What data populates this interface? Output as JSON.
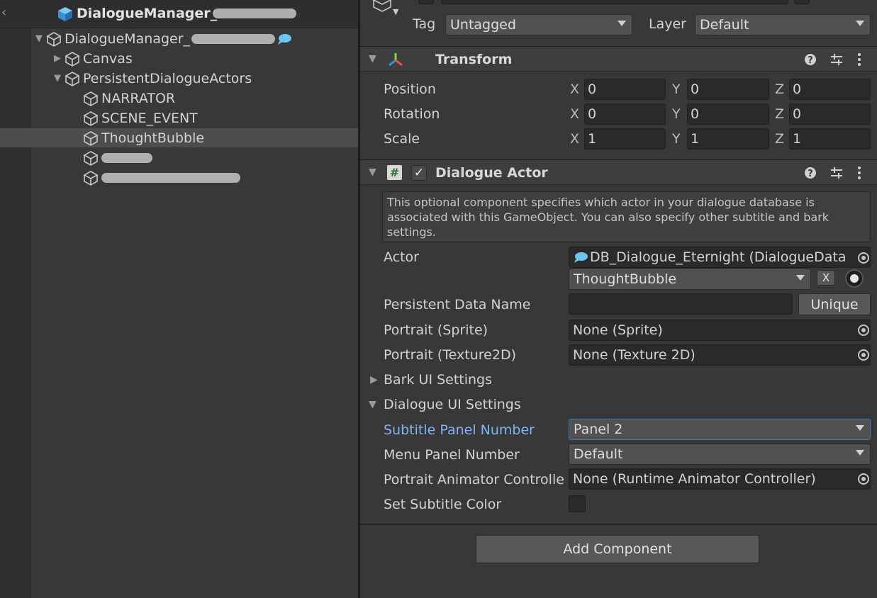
{
  "hierarchy": {
    "scene_name": "DialogueManager_",
    "items": [
      {
        "label": "DialogueManager_",
        "expanded": true,
        "icon": "speech-bubble-icon"
      },
      {
        "label": "Canvas",
        "expanded": false
      },
      {
        "label": "PersistentDialogueActors",
        "expanded": true
      },
      {
        "label": "NARRATOR"
      },
      {
        "label": "SCENE_EVENT"
      },
      {
        "label": "ThoughtBubble",
        "selected": true
      }
    ]
  },
  "inspector": {
    "tag_label": "Tag",
    "tag_value": "Untagged",
    "layer_label": "Layer",
    "layer_value": "Default",
    "transform": {
      "title": "Transform",
      "rows": [
        {
          "label": "Position",
          "x": "0",
          "y": "0",
          "z": "0"
        },
        {
          "label": "Rotation",
          "x": "0",
          "y": "0",
          "z": "0"
        },
        {
          "label": "Scale",
          "x": "1",
          "y": "1",
          "z": "1"
        }
      ],
      "axis_x": "X",
      "axis_y": "Y",
      "axis_z": "Z"
    },
    "dialogue_actor": {
      "title": "Dialogue Actor",
      "enabled": true,
      "help_text": "This optional component specifies which actor in your dialogue database is associated with this GameObject. You can also specify other subtitle and bark settings.",
      "actor_label": "Actor",
      "actor_database": "DB_Dialogue_Eternight (DialogueData",
      "actor_value": "ThoughtBubble",
      "clear_button": "X",
      "persistent_label": "Persistent Data Name",
      "persistent_value": "",
      "unique_button": "Unique",
      "portrait_sprite_label": "Portrait (Sprite)",
      "portrait_sprite_value": "None (Sprite)",
      "portrait_tex_label": "Portrait (Texture2D)",
      "portrait_tex_value": "None (Texture 2D)",
      "bark_settings_label": "Bark UI Settings",
      "dialogue_settings_label": "Dialogue UI Settings",
      "subtitle_panel_label": "Subtitle Panel Number",
      "subtitle_panel_value": "Panel 2",
      "menu_panel_label": "Menu Panel Number",
      "menu_panel_value": "Default",
      "animator_label": "Portrait Animator Controlle",
      "animator_value": "None (Runtime Animator Controller)",
      "subtitle_color_label": "Set Subtitle Color",
      "subtitle_color_checked": false
    },
    "add_component_button": "Add Component"
  },
  "colors": {
    "panel_bg": "#383838",
    "selected_row": "#4d4d4d",
    "active_label": "#7fb4f5",
    "focus_border": "#3a79bb"
  }
}
